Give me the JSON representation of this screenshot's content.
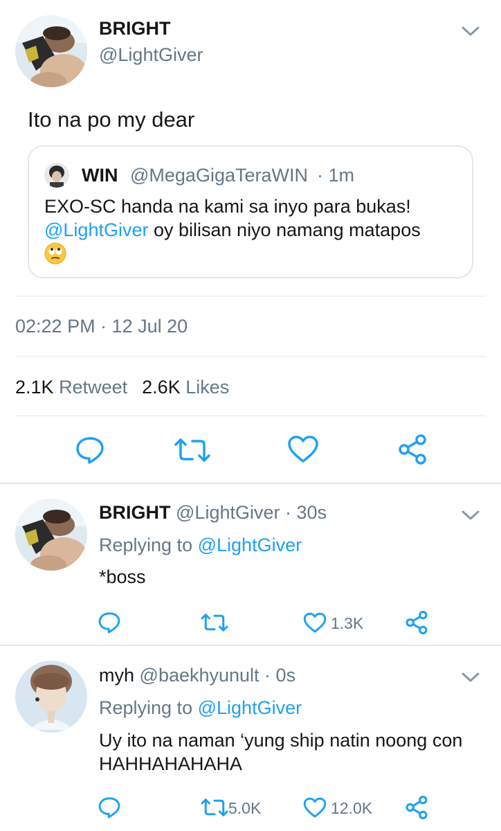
{
  "main_tweet": {
    "display_name": "BRIGHT",
    "handle": "@LightGiver",
    "text": "Ito na po my dear",
    "timestamp": "02:22 PM · 12 Jul 20",
    "retweets_count": "2.1K",
    "retweets_label": "Retweet",
    "likes_count": "2.6K",
    "likes_label": "Likes"
  },
  "quoted_tweet": {
    "display_name": "WIN",
    "handle": "@MegaGigaTeraWIN",
    "time": "· 1m",
    "line1": "EXO-SC handa na kami sa inyo para bukas!",
    "mention": "@LightGiver",
    "line2_rest": "oy bilisan niyo namang matapos",
    "emoji": "🙄"
  },
  "replies": [
    {
      "display_name": "BRIGHT",
      "handle_time": "@LightGiver · 30s",
      "replying_prefix": "Replying to",
      "replying_to": "@LightGiver",
      "text": "*boss",
      "retweets": "",
      "likes": "1.3K"
    },
    {
      "display_name": "myh",
      "handle_time": "@baekhyunult · 0s",
      "replying_prefix": "Replying to",
      "replying_to": "@LightGiver",
      "text_line1": "Uy ito na naman ‘yung ship natin noong con",
      "text_line2": "HAHHAHAHAHA",
      "retweets": "5.0K",
      "likes": "12.0K"
    }
  ],
  "icons": [
    "chevron-down-icon",
    "reply-icon",
    "retweet-icon",
    "like-icon",
    "share-icon"
  ],
  "colors": {
    "accent": "#1da1f2",
    "secondary_text": "#657786",
    "divider": "#e1e8ed",
    "icon": "#1da1f2"
  }
}
